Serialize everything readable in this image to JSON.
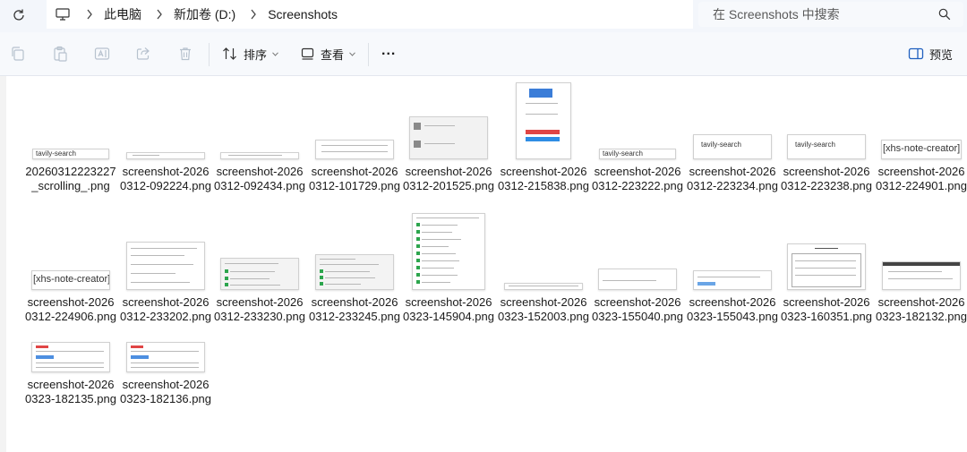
{
  "window": {
    "breadcrumb": [
      "此电脑",
      "新加卷 (D:)",
      "Screenshots"
    ],
    "search_placeholder": "在 Screenshots 中搜索"
  },
  "toolbar": {
    "sort_label": "排序",
    "view_label": "查看",
    "more_label": "...",
    "preview_label": "预览"
  },
  "thumb_text": {
    "tavily": "tavily-search",
    "xhs": "[xhs-note-creator]"
  },
  "files": [
    {
      "name": "20260312223227_scrolling_.png"
    },
    {
      "name": "screenshot-20260312-092224.png"
    },
    {
      "name": "screenshot-20260312-092434.png"
    },
    {
      "name": "screenshot-20260312-101729.png"
    },
    {
      "name": "screenshot-20260312-201525.png"
    },
    {
      "name": "screenshot-20260312-215838.png"
    },
    {
      "name": "screenshot-20260312-223222.png"
    },
    {
      "name": "screenshot-20260312-223234.png"
    },
    {
      "name": "screenshot-20260312-223238.png"
    },
    {
      "name": "screenshot-20260312-224901.png"
    },
    {
      "name": "screenshot-20260312-224906.png"
    },
    {
      "name": "screenshot-20260312-233202.png"
    },
    {
      "name": "screenshot-20260312-233230.png"
    },
    {
      "name": "screenshot-20260312-233245.png"
    },
    {
      "name": "screenshot-20260323-145904.png"
    },
    {
      "name": "screenshot-20260323-152003.png"
    },
    {
      "name": "screenshot-20260323-155040.png"
    },
    {
      "name": "screenshot-20260323-155043.png"
    },
    {
      "name": "screenshot-20260323-160351.png"
    },
    {
      "name": "screenshot-20260323-182132.png"
    },
    {
      "name": "screenshot-20260323-182135.png"
    },
    {
      "name": "screenshot-20260323-182136.png"
    }
  ]
}
